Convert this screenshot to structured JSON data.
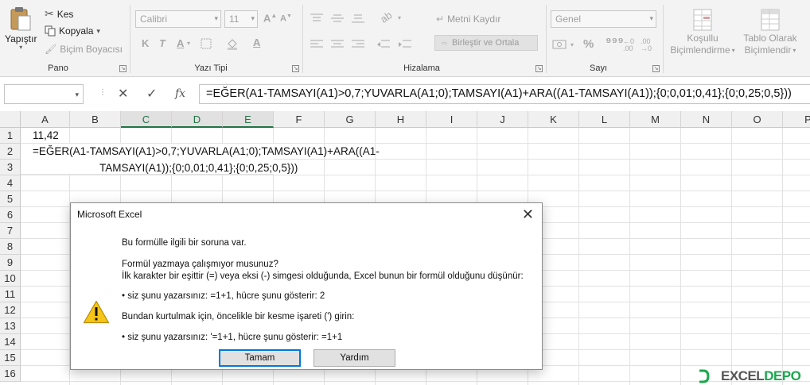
{
  "ribbon": {
    "clipboard": {
      "paste_label": "Yapıştır",
      "cut_label": "Kes",
      "copy_label": "Kopyala",
      "format_painter_label": "Biçim Boyacısı",
      "group_label": "Pano"
    },
    "font": {
      "font_name": "Calibri",
      "font_size": "11",
      "bold": "K",
      "italic": "T",
      "underline": "A",
      "group_label": "Yazı Tipi"
    },
    "alignment": {
      "wrap_text_label": "Metni Kaydır",
      "merge_center_label": "Birleştir ve Ortala",
      "group_label": "Hizalama"
    },
    "number": {
      "format_value": "Genel",
      "percent_glyph": "%",
      "group_label": "Sayı"
    },
    "styles": {
      "conditional_formatting_line1": "Koşullu",
      "conditional_formatting_line2": "Biçimlendirme",
      "format_table_line1": "Tablo Olarak",
      "format_table_line2": "Biçimlendir"
    }
  },
  "formula_bar": {
    "name_box_value": "",
    "cancel_glyph": "✕",
    "enter_glyph": "✓",
    "fx_label": "fx",
    "formula": "=EĞER(A1-TAMSAYI(A1)>0,7;YUVARLA(A1;0);TAMSAYI(A1)+ARA((A1-TAMSAYI(A1));{0;0,01;0,41};{0;0,25;0,5}))"
  },
  "sheet": {
    "columns": [
      "A",
      "B",
      "C",
      "D",
      "E",
      "F",
      "G",
      "H",
      "I",
      "J",
      "K",
      "L",
      "M",
      "N",
      "O",
      "P"
    ],
    "rows": [
      "1",
      "2",
      "3",
      "4",
      "5",
      "6",
      "7",
      "8",
      "9",
      "10",
      "11",
      "12",
      "13",
      "14",
      "15",
      "16"
    ],
    "cells": {
      "a1": "11,42",
      "a2_line1": "=EĞER(A1-TAMSAYI(A1)>0,7;YUVARLA(A1;0);TAMSAYI(A1)+ARA((A1-",
      "a2_line2": "TAMSAYI(A1));{0;0,01;0,41};{0;0,25;0,5}))"
    }
  },
  "dialog": {
    "title": "Microsoft Excel",
    "close_glyph": "✕",
    "line_problem": "Bu formülle ilgili bir soruna var.",
    "line_question": "Formül yazmaya çalışmıyor musunuz?",
    "line_explain": "İlk karakter bir eşittir (=) veya eksi (-) simgesi olduğunda, Excel bunun bir formül olduğunu düşünür:",
    "line_example1": "• siz şunu yazarsınız:   =1+1, hücre şunu gösterir:   2",
    "line_fix": "Bundan kurtulmak için, öncelikle bir kesme işareti (') girin:",
    "line_example2": "• siz şunu yazarsınız:   '=1+1, hücre şunu gösterir:   =1+1",
    "ok_label": "Tamam",
    "help_label": "Yardım"
  },
  "watermark": {
    "part_a": "EXCEL",
    "part_b": "DEPO"
  },
  "colors": {
    "excel_green": "#217346",
    "dialog_accent": "#0078d7",
    "warning_yellow": "#f5c518"
  }
}
